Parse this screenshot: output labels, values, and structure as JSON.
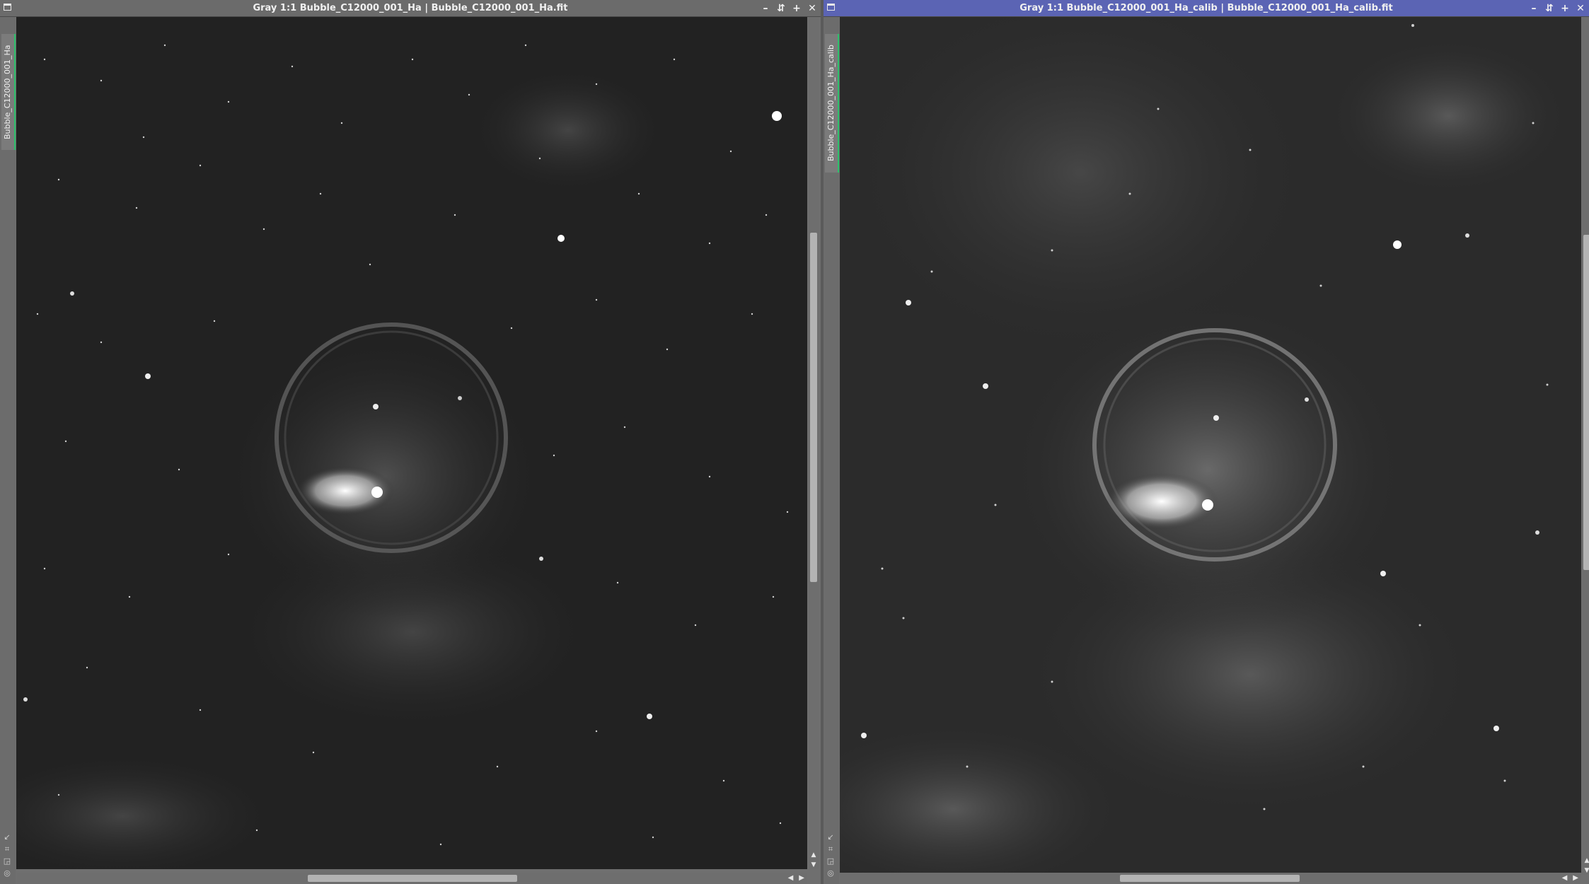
{
  "windows": [
    {
      "id": "left",
      "title": "Gray 1:1 Bubble_C12000_001_Ha | Bubble_C12000_001_Ha.fit",
      "side_label": "Bubble_C12000_001_Ha",
      "active": false,
      "buttons": {
        "minimize": "–",
        "shade": "⇵",
        "maximize": "+",
        "close": "✕"
      }
    },
    {
      "id": "right",
      "title": "Gray 1:1 Bubble_C12000_001_Ha_calib | Bubble_C12000_001_Ha_calib.fit",
      "side_label": "Bubble_C12000_001_Ha_calib",
      "active": true,
      "buttons": {
        "minimize": "–",
        "shade": "⇵",
        "maximize": "+",
        "close": "✕"
      }
    }
  ],
  "colors": {
    "active_titlebar": "#5b64b4",
    "inactive_titlebar": "#6b6b6b",
    "side_tab_accent": "#2cbf6a"
  },
  "icons": [
    "window-menu-icon",
    "minimize-icon",
    "shade-icon",
    "maximize-icon",
    "close-icon",
    "navigation-icon",
    "zoom-icon",
    "stf-icon",
    "preview-icon"
  ]
}
